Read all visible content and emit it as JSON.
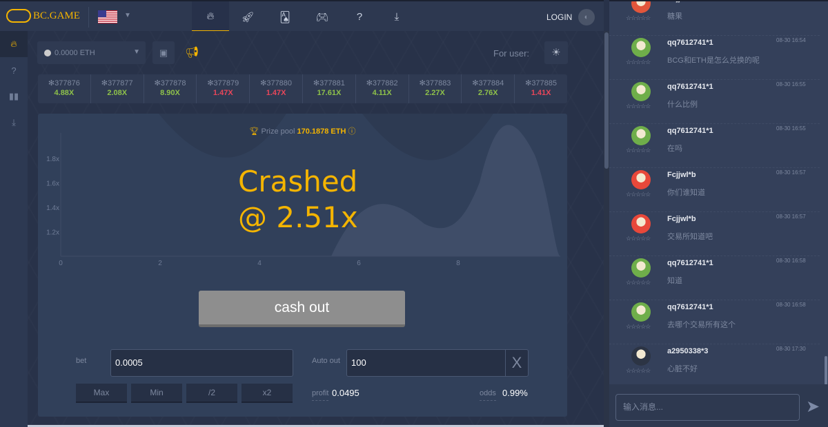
{
  "header": {
    "brand": "BC.GAME",
    "login": "LOGIN",
    "nav_icons": [
      "fire-icon",
      "rocket-icon",
      "cards-icon",
      "gamepad-icon",
      "help-icon",
      "download-icon"
    ],
    "active_tab": 0
  },
  "sidebar": {
    "icons": [
      "fire-icon",
      "help-icon",
      "stats-icon",
      "download-icon"
    ]
  },
  "toolbar": {
    "balance": "0.0000 ETH",
    "announcement": "For user:"
  },
  "history": [
    {
      "id": "377876",
      "mult": "4.88X",
      "status": "win"
    },
    {
      "id": "377877",
      "mult": "2.08X",
      "status": "win"
    },
    {
      "id": "377878",
      "mult": "8.90X",
      "status": "win"
    },
    {
      "id": "377879",
      "mult": "1.47X",
      "status": "lose"
    },
    {
      "id": "377880",
      "mult": "1.47X",
      "status": "lose"
    },
    {
      "id": "377881",
      "mult": "17.61X",
      "status": "win"
    },
    {
      "id": "377882",
      "mult": "4.11X",
      "status": "win"
    },
    {
      "id": "377883",
      "mult": "2.27X",
      "status": "win"
    },
    {
      "id": "377884",
      "mult": "2.76X",
      "status": "win"
    },
    {
      "id": "377885",
      "mult": "1.41X",
      "status": "lose"
    }
  ],
  "game": {
    "prize_label": "Prize pool",
    "prize_value": "170.1878 ETH",
    "crashed_line1": "Crashed",
    "crashed_line2": "@ 2.51x",
    "chart_data": {
      "type": "area",
      "x_ticks": [
        "0",
        "2",
        "4",
        "6",
        "8"
      ],
      "y_ticks": [
        "1.2x",
        "1.4x",
        "1.6x",
        "1.8x"
      ],
      "xlim": [
        0,
        10
      ],
      "ylim": [
        1.0,
        2.0
      ]
    }
  },
  "controls": {
    "cashout": "cash out",
    "bet_label": "bet",
    "bet_value": "0.0005",
    "auto_label": "Auto out",
    "auto_value": "100",
    "clear": "X",
    "buttons": [
      "Max",
      "Min",
      "/2",
      "x2"
    ],
    "profit_label": "profit",
    "profit_value": "0.0495",
    "odds_label": "odds",
    "odds_value": "0.99%"
  },
  "colors": {
    "accent": "#f4b400",
    "win": "#8ec14a",
    "lose": "#e8465a"
  },
  "chat": {
    "placeholder": "输入消息...",
    "messages": [
      {
        "user": "Fcjjwl*b",
        "time": "",
        "text": "糖果",
        "avatar": "#e2563b"
      },
      {
        "user": "qq7612741*1",
        "time": "08-30 16:54",
        "text": "BCG和ETH是怎么兑换的呢",
        "avatar": "#6fae4a"
      },
      {
        "user": "qq7612741*1",
        "time": "08-30 16:55",
        "text": "什么比例",
        "avatar": "#6fae4a"
      },
      {
        "user": "qq7612741*1",
        "time": "08-30 16:55",
        "text": "在吗",
        "avatar": "#6fae4a"
      },
      {
        "user": "Fcjjwl*b",
        "time": "08-30 16:57",
        "text": "你们谁知道",
        "avatar": "#e8483a"
      },
      {
        "user": "Fcjjwl*b",
        "time": "08-30 16:57",
        "text": "交易所知道吧",
        "avatar": "#e8483a"
      },
      {
        "user": "qq7612741*1",
        "time": "08-30 16:58",
        "text": "知道",
        "avatar": "#6fae4a"
      },
      {
        "user": "qq7612741*1",
        "time": "08-30 16:58",
        "text": "去哪个交易所有这个",
        "avatar": "#6fae4a"
      },
      {
        "user": "a2950338*3",
        "time": "08-30 17:30",
        "text": "心脏不好",
        "avatar": "#2c3444"
      }
    ]
  }
}
